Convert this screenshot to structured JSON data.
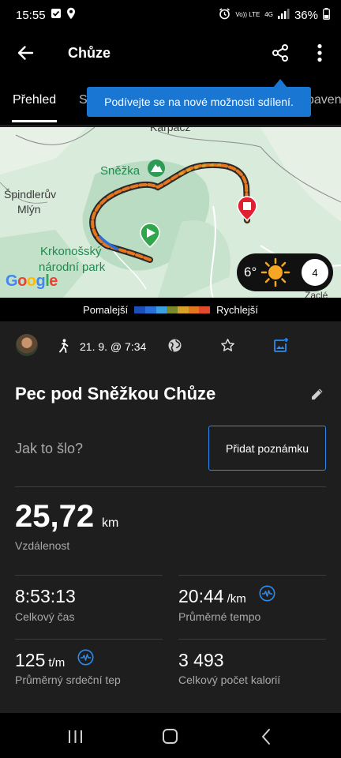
{
  "status": {
    "time": "15:55",
    "battery": "36%",
    "signal_small": "Vo)) LTE",
    "signal_4g": "4G"
  },
  "header": {
    "title": "Chůze"
  },
  "tabs": [
    {
      "label": "Přehled"
    },
    {
      "label": "S"
    },
    {
      "label": "paven"
    }
  ],
  "tooltip": {
    "text": "Podívejte se na nové možnosti sdílení."
  },
  "map": {
    "labels": {
      "karpacz": "Karpacz",
      "snezka": "Sněžka",
      "spindleruv_1": "Špindlerův",
      "spindleruv_2": "Mlýn",
      "park_1": "Krkonošský",
      "park_2": "národní park",
      "zacler": "Žaclé",
      "google": "Google"
    },
    "weather": {
      "temperature": "6°",
      "wind": "4"
    }
  },
  "speed_legend": {
    "slower": "Pomalejší",
    "faster": "Rychlejší",
    "colors": [
      "#1c4fb8",
      "#2b6fd9",
      "#3aa0e0",
      "#7a8a2a",
      "#d6a22a",
      "#e4761f",
      "#e24a2b"
    ]
  },
  "meta": {
    "date": "21. 9. @ 7:34"
  },
  "activity": {
    "name": "Pec pod Sněžkou Chůze"
  },
  "feeling": {
    "prompt": "Jak to šlo?",
    "add_note": "Přidat poznámku"
  },
  "stats": {
    "distance": {
      "value": "25,72",
      "unit": "km",
      "label": "Vzdálenost"
    },
    "total_time": {
      "value": "8:53:13",
      "label": "Celkový čas"
    },
    "avg_pace": {
      "value": "20:44",
      "unit": "/km",
      "label": "Průměrné tempo"
    },
    "avg_hr": {
      "value": "125",
      "unit": "t/m",
      "label": "Průměrný srdeční tep"
    },
    "calories": {
      "value": "3 493",
      "label": "Celkový počet kalorií"
    }
  }
}
